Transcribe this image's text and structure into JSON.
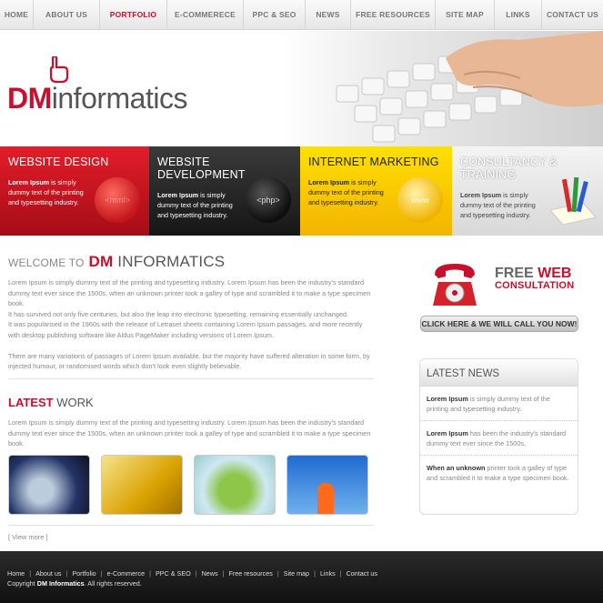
{
  "nav": {
    "items": [
      {
        "label": "Home",
        "active": false
      },
      {
        "label": "About Us",
        "active": false
      },
      {
        "label": "Portfolio",
        "active": true
      },
      {
        "label": "E-Commerece",
        "active": false
      },
      {
        "label": "PPC & SEO",
        "active": false
      },
      {
        "label": "News",
        "active": false
      },
      {
        "label": "Free Resources",
        "active": false
      },
      {
        "label": "Site Map",
        "active": false
      },
      {
        "label": "Links",
        "active": false
      },
      {
        "label": "Contact Us",
        "active": false
      }
    ]
  },
  "brand": {
    "prefix": "DM",
    "name": "informatics"
  },
  "services": [
    {
      "title": "Website Design",
      "bold": "Lorem Ipsum",
      "text": " is simply dummy text of the printing and typesetting industry.",
      "badge": "<html>"
    },
    {
      "title": "Website Development",
      "bold": "Lorem Ipsum",
      "text": " is simply dummy text of the printing and typesetting industry.",
      "badge": "<php>"
    },
    {
      "title": "Internet Marketing",
      "bold": "Lorem Ipsum",
      "text": " is simply dummy text of the printing and typesetting industry.",
      "badge": "www"
    },
    {
      "title": "Consultancy & Training",
      "bold": "Lorem Ipsum",
      "text": " is simply dummy text of the printing and typesetting industry.",
      "badge": ""
    }
  ],
  "welcome": {
    "label": "WELCOME TO",
    "dm": "DM",
    "name": "INFORMATICS",
    "p1": "Lorem Ipsum is simply dummy text of the printing and typesetting industry. Lorem Ipsum has been the industry's standard dummy text ever since the 1500s, when an unknown printer took a galley of type and scrambled it to make a type specimen book.",
    "p2": "It has survived not only five centuries, but also the leap into electronic typesetting, remaining essentially unchanged.",
    "p3": "It was popularised in the 1960s with the release of Letraset sheets containing Lorem Ipsum passages, and more recently with desktop publishing software like Aldus PageMaker including versions of Lorem Ipsum.",
    "p4": "There are many variations of passages of Lorem Ipsum available, but the majority have suffered alteration in some form, by injected humour, or randomised words which don't look even slightly believable."
  },
  "latest": {
    "label1": "LATEST",
    "label2": "WORK",
    "text": "Lorem Ipsum is simply dummy text of the printing and typesetting industry. Lorem Ipsum has been the industry's standard dummy text ever since the 1500s, when an unknown printer took a galley of type and scrambled it to make a type specimen book.",
    "view_more": "[ View more ]"
  },
  "consult": {
    "free": "FREE",
    "web": "WEB",
    "consultation": "CONSULTATION",
    "call": "CLICK HERE & WE WILL CALL YOU NOW!"
  },
  "news": {
    "title": "LATEST NEWS",
    "items": [
      {
        "bold": "Lorem Ipsum",
        "text": " is simply dummy text of the printing and typesetting industry."
      },
      {
        "bold": "Lorem Ipsum",
        "text": " has been the industry's standard dummy text ever since the 1500s,"
      },
      {
        "bold": "When an unknown",
        "text": " printer took a galley of type and scrambled it to make a type specimen book."
      }
    ]
  },
  "footer": {
    "links": [
      "Home",
      "About us",
      "Portfolio",
      "e-Commerce",
      "PPC & SEO",
      "News",
      "Free resources",
      "Site map",
      "Links",
      "Contact us"
    ],
    "copyright_prefix": "Copyright",
    "copyright_name": "DM Informatics",
    "copyright_suffix": ". All rights reserved."
  },
  "colors": {
    "brand_red": "#c8102e"
  }
}
